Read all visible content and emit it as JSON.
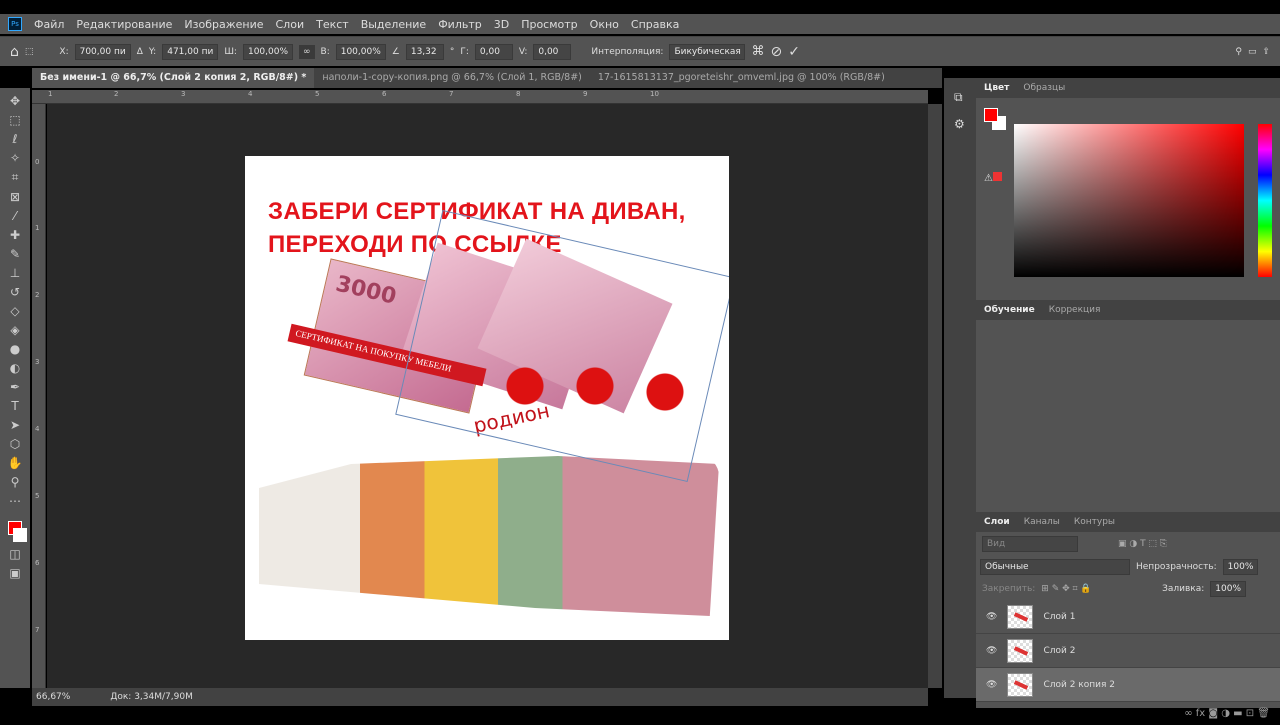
{
  "menu": [
    "Файл",
    "Редактирование",
    "Изображение",
    "Слои",
    "Текст",
    "Выделение",
    "Фильтр",
    "3D",
    "Просмотр",
    "Окно",
    "Справка"
  ],
  "options": {
    "x_label": "X:",
    "x": "700,00 пи",
    "y_label": "Y:",
    "y": "471,00 пи",
    "w_label": "Ш:",
    "w": "100,00%",
    "h_label": "В:",
    "h": "100,00%",
    "angle": "13,32",
    "deg": "°",
    "hskew_label": "Г:",
    "hskew": "0,00",
    "vskew_label": "V:",
    "vskew": "0,00",
    "interp_label": "Интерполяция:",
    "interp": "Бикубическая"
  },
  "tabs": [
    "Без имени-1 @ 66,7% (Слой 2 копия 2, RGB/8#) *",
    "наполи-1-copy-копия.png @ 66,7% (Слой 1, RGB/8#)",
    "17-1615813137_pgoreteishr_omveml.jpg @ 100% (RGB/8#)"
  ],
  "ruler_top": [
    "1",
    "2",
    "3",
    "4",
    "5",
    "6",
    "7",
    "8",
    "9",
    "10"
  ],
  "ruler_left": [
    "0",
    "1",
    "2",
    "3",
    "4",
    "5",
    "6",
    "7"
  ],
  "doc": {
    "line1": "ЗАБЕРИ СЕРТИФИКАТ НА ДИВАН,",
    "line2": "ПЕРЕХОДИ ПО ССЫЛКЕ",
    "ribbon": "СЕРТИФИКАТ НА ПОКУПКУ МЕБЕЛИ",
    "bill": "3000",
    "brand": "родион"
  },
  "status": {
    "zoom": "66,67%",
    "doc": "Док: 3,34M/7,90M"
  },
  "color_panel": {
    "tabs": [
      "Цвет",
      "Образцы"
    ],
    "fg": "#ff0000",
    "bg": "#ffffff"
  },
  "adjust_panel": {
    "tabs": [
      "Обучение",
      "Коррекция"
    ]
  },
  "layers_panel": {
    "tabs": [
      "Слои",
      "Каналы",
      "Контуры"
    ],
    "search": "Вид",
    "blend": "Обычные",
    "opacity_label": "Непрозрачность:",
    "opacity": "100%",
    "lock_label": "Закрепить:",
    "fill_label": "Заливка:",
    "fill": "100%",
    "layers": [
      "Слой 1",
      "Слой 2",
      "Слой 2 копия 2"
    ]
  }
}
